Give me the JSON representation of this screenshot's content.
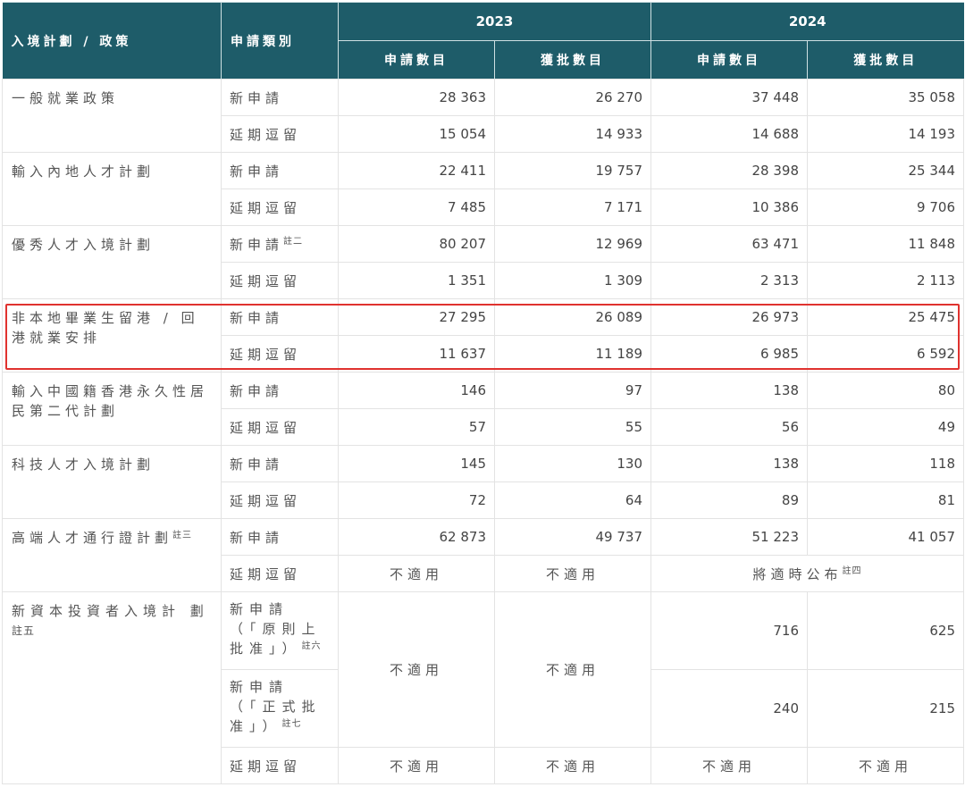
{
  "header": {
    "col_policy": "入境計劃 / 政策",
    "col_type": "申請類別",
    "year_2023": "2023",
    "year_2024": "2024",
    "sub_applications": "申請數目",
    "sub_approvals": "獲批數目"
  },
  "rows": {
    "general": {
      "policy": "一般就業政策",
      "new_label": "新申請",
      "ext_label": "延期逗留",
      "new": [
        "28 363",
        "26 270",
        "37 448",
        "35 058"
      ],
      "ext": [
        "15 054",
        "14 933",
        "14 688",
        "14 193"
      ]
    },
    "mainland": {
      "policy": "輸入內地人才計劃",
      "new_label": "新申請",
      "ext_label": "延期逗留",
      "new": [
        "22 411",
        "19 757",
        "28 398",
        "25 344"
      ],
      "ext": [
        "7 485",
        "7 171",
        "10 386",
        "9 706"
      ]
    },
    "quality": {
      "policy": "優秀人才入境計劃",
      "new_label": "新申請",
      "new_note": "註二",
      "ext_label": "延期逗留",
      "new": [
        "80 207",
        "12 969",
        "63 471",
        "11 848"
      ],
      "ext": [
        "1 351",
        "1 309",
        "2 313",
        "2 113"
      ]
    },
    "iang": {
      "policy": "非本地畢業生留港 / 回港就業安排",
      "new_label": "新申請",
      "ext_label": "延期逗留",
      "new": [
        "27 295",
        "26 089",
        "26 973",
        "25 475"
      ],
      "ext": [
        "11 637",
        "11 189",
        "6 985",
        "6 592"
      ]
    },
    "second_gen": {
      "policy": "輸入中國籍香港永久性居民第二代計劃",
      "new_label": "新申請",
      "ext_label": "延期逗留",
      "new": [
        "146",
        "97",
        "138",
        "80"
      ],
      "ext": [
        "57",
        "55",
        "56",
        "49"
      ]
    },
    "techtas": {
      "policy": "科技人才入境計劃",
      "new_label": "新申請",
      "ext_label": "延期逗留",
      "new": [
        "145",
        "130",
        "138",
        "118"
      ],
      "ext": [
        "72",
        "64",
        "89",
        "81"
      ]
    },
    "ttps": {
      "policy": "高端人才通行證計劃",
      "policy_note": "註三",
      "new_label": "新申請",
      "ext_label": "延期逗留",
      "new": [
        "62 873",
        "49 737",
        "51 223",
        "41 057"
      ],
      "ext_na_2023a": "不適用",
      "ext_na_2023b": "不適用",
      "ext_2024": "將適時公布",
      "ext_2024_note": "註四"
    },
    "ciies": {
      "policy": "新資本投資者入境計 劃",
      "policy_note": "註五",
      "new1_label": "新申請（「原則上批准」）",
      "new1_note": "註六",
      "new2_label": "新申請（「正式批准」）",
      "new2_note": "註七",
      "ext_label": "延期逗留",
      "na_2023a": "不適用",
      "na_2023b": "不適用",
      "new1_2024": [
        "716",
        "625"
      ],
      "new2_2024": [
        "240",
        "215"
      ],
      "ext_na": [
        "不適用",
        "不適用",
        "不適用",
        "不適用"
      ]
    }
  },
  "highlight_color": "#e0322f",
  "header_color": "#1e5c69"
}
